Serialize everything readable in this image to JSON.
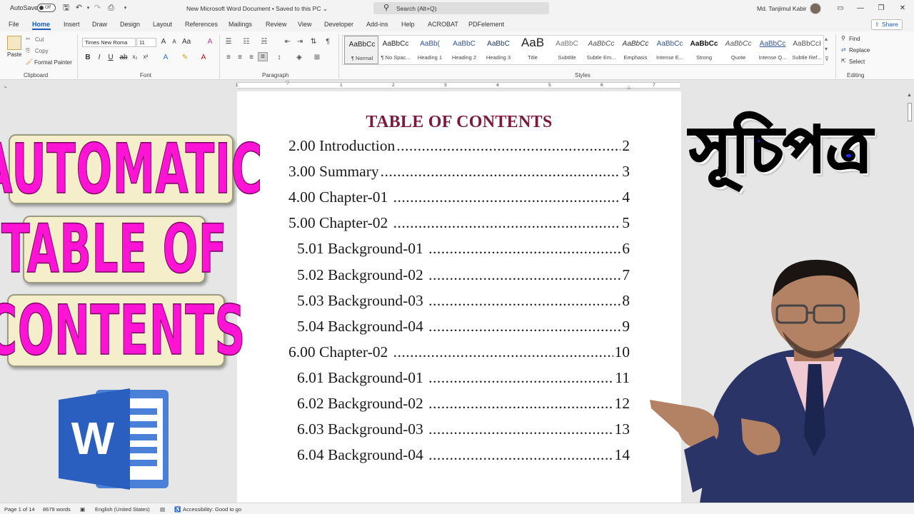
{
  "titlebar": {
    "autosave_label": "AutoSave",
    "autosave_state": "Off",
    "document_title": "New Microsoft Word Document • Saved to this PC",
    "search_placeholder": "Search (Alt+Q)",
    "user_name": "Md. Tanjimul Kabir"
  },
  "ribbon_tabs": [
    "File",
    "Home",
    "Insert",
    "Draw",
    "Design",
    "Layout",
    "References",
    "Mailings",
    "Review",
    "View",
    "Developer",
    "Add-ins",
    "Help",
    "ACROBAT",
    "PDFelement"
  ],
  "active_tab": "Home",
  "share_label": "Share",
  "clipboard": {
    "paste": "Paste",
    "cut": "Cut",
    "copy": "Copy",
    "format_painter": "Format Painter",
    "group_label": "Clipboard"
  },
  "font": {
    "family": "Times New Roma",
    "size": "11",
    "group_label": "Font"
  },
  "paragraph": {
    "group_label": "Paragraph"
  },
  "styles": {
    "group_label": "Styles",
    "items": [
      {
        "sample": "AaBbCc",
        "name": "¶ Normal",
        "color": "#222222"
      },
      {
        "sample": "AaBbCc",
        "name": "¶ No Spac...",
        "color": "#222222"
      },
      {
        "sample": "AaBb(",
        "name": "Heading 1",
        "color": "#2f5597"
      },
      {
        "sample": "AaBbC",
        "name": "Heading 2",
        "color": "#2f5597"
      },
      {
        "sample": "AaBbC",
        "name": "Heading 3",
        "color": "#1f3864"
      },
      {
        "sample": "AaB",
        "name": "Title",
        "color": "#222222"
      },
      {
        "sample": "AaBbC",
        "name": "Subtitle",
        "color": "#777777"
      },
      {
        "sample": "AaBbCc",
        "name": "Subtle Em...",
        "color": "#555555"
      },
      {
        "sample": "AaBbCc",
        "name": "Emphasis",
        "color": "#333333"
      },
      {
        "sample": "AaBbCc",
        "name": "Intense E...",
        "color": "#2f5597"
      },
      {
        "sample": "AaBbCc",
        "name": "Strong",
        "color": "#111111"
      },
      {
        "sample": "AaBbCc",
        "name": "Quote",
        "color": "#555555"
      },
      {
        "sample": "AaBbCc",
        "name": "Intense Q...",
        "color": "#2f5597"
      },
      {
        "sample": "AaBbCcI",
        "name": "Subtle Ref...",
        "color": "#555555"
      }
    ]
  },
  "editing": {
    "find": "Find",
    "replace": "Replace",
    "select": "Select",
    "group_label": "Editing"
  },
  "ruler_numbers": [
    "1",
    "1",
    "2",
    "3",
    "4",
    "5",
    "6",
    "7"
  ],
  "document": {
    "heading": "TABLE OF CONTENTS",
    "entries": [
      {
        "label": "2.00 Introduction",
        "page": "2",
        "level": 1
      },
      {
        "label": "3.00 Summary",
        "page": "3",
        "level": 1
      },
      {
        "label": "4.00 Chapter-01 ",
        "page": "4",
        "level": 1
      },
      {
        "label": "5.00 Chapter-02 ",
        "page": "5",
        "level": 1
      },
      {
        "label": "5.01 Background-01 ",
        "page": "6",
        "level": 2
      },
      {
        "label": "5.02 Background-02 ",
        "page": "7",
        "level": 2
      },
      {
        "label": "5.03 Background-03 ",
        "page": "8",
        "level": 2
      },
      {
        "label": "5.04 Background-04 ",
        "page": "9",
        "level": 2
      },
      {
        "label": "6.00 Chapter-02 ",
        "page": "10",
        "level": 1
      },
      {
        "label": "6.01 Background-01 ",
        "page": "11",
        "level": 2
      },
      {
        "label": "6.02 Background-02 ",
        "page": "12",
        "level": 2
      },
      {
        "label": "6.03 Background-03 ",
        "page": "13",
        "level": 2
      },
      {
        "label": "6.04 Background-04 ",
        "page": "14",
        "level": 2
      }
    ]
  },
  "overlay": {
    "line1": "AUTOMATIC",
    "line2": "TABLE OF",
    "line3": "CONTENTS",
    "bengali_title": "সূচিপত্র",
    "logo_letter": "W"
  },
  "statusbar": {
    "page": "Page 1 of 14",
    "words": "8679 words",
    "language": "English (United States)",
    "accessibility": "Accessibility: Good to go"
  }
}
